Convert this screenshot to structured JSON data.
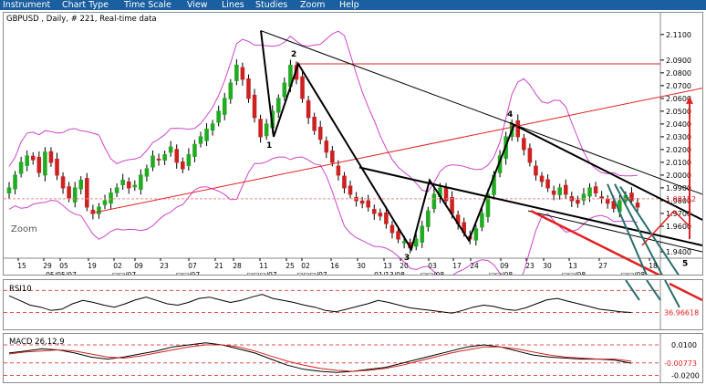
{
  "menu": [
    "Instrument",
    "Chart Type",
    "Time Scale",
    "View",
    "Lines",
    "Studies",
    "Zoom",
    "Help"
  ],
  "chart_header": "GBPUSD , Daily, # 221, Real-time data",
  "zoom_label": "Zoom",
  "colors": {
    "menubar": "#1a5f9f",
    "up": "#22aa22",
    "down": "#cc2222",
    "bands": "#cc44cc",
    "trend_red": "#e02020",
    "fan": "#2a6e6e"
  },
  "chart_data": [
    {
      "type": "candlestick",
      "title": "GBPUSD , Daily, # 221, Real-time data",
      "y_ticks": [
        "2.1100",
        "2.0900",
        "2.0800",
        "2.0700",
        "2.0600",
        "2.0500",
        "2.0400",
        "2.0300",
        "2.0200",
        "2.0100",
        "2.0000",
        "1.9900",
        "1.9800",
        "1.9700",
        "1.9600",
        "1.9400"
      ],
      "y_tick_values": [
        2.11,
        2.09,
        2.08,
        2.07,
        2.06,
        2.05,
        2.04,
        2.03,
        2.02,
        2.01,
        2.0,
        1.99,
        1.98,
        1.97,
        1.96,
        1.94
      ],
      "price_marker": "1.98152",
      "ylim": [
        1.935,
        2.117
      ],
      "x_day_labels": [
        "15",
        "29",
        "05",
        "19",
        "02",
        "09",
        "23",
        "07",
        "21",
        "28",
        "11",
        "25",
        "02",
        "16",
        "30",
        "13",
        "20",
        "03",
        "17",
        "24",
        "09",
        "23",
        "30",
        "13",
        "27",
        "18"
      ],
      "x_date_labels": [
        "05/05/07",
        "□□/07",
        "□□/07",
        "□□□/07",
        "□□□/07",
        "01/13/08",
        "□□/08",
        "□□/08",
        "□□/08",
        "□□/08"
      ],
      "wave_labels": [
        "1",
        "2",
        "3",
        "4",
        "5"
      ],
      "wave_points": [
        {
          "label": "1",
          "price": 2.03
        },
        {
          "label": "2",
          "price": 2.087
        },
        {
          "label": "3",
          "price": 1.942
        },
        {
          "label": "4",
          "price": 2.04
        },
        {
          "label": "5",
          "price": 1.9375
        }
      ],
      "close_series": [
        1.99,
        2.0,
        2.01,
        2.015,
        2.012,
        2.002,
        2.018,
        2.01,
        2.0,
        1.99,
        1.982,
        1.99,
        1.996,
        1.975,
        1.97,
        1.975,
        1.98,
        1.986,
        1.99,
        1.996,
        1.99,
        1.992,
        2.0,
        2.005,
        2.015,
        2.012,
        2.016,
        2.022,
        2.01,
        2.005,
        2.016,
        2.024,
        2.03,
        2.036,
        2.04,
        2.05,
        2.06,
        2.072,
        2.086,
        2.075,
        2.06,
        2.045,
        2.03,
        2.04,
        2.05,
        2.06,
        2.072,
        2.086,
        2.075,
        2.06,
        2.045,
        2.035,
        2.028,
        2.018,
        2.01,
        2.0,
        1.99,
        1.985,
        1.98,
        1.978,
        1.975,
        1.97,
        1.968,
        1.962,
        1.955,
        1.95,
        1.948,
        1.943,
        1.95,
        1.96,
        1.972,
        1.985,
        1.99,
        1.98,
        1.97,
        1.962,
        1.955,
        1.95,
        1.958,
        1.97,
        1.985,
        2.0,
        2.015,
        2.03,
        2.04,
        2.03,
        2.02,
        2.01,
        2.0,
        1.995,
        1.99,
        1.985,
        1.99,
        1.985,
        1.98,
        1.978,
        1.985,
        1.99,
        1.986,
        1.982,
        1.978,
        1.974,
        1.98,
        1.984,
        1.98,
        1.975
      ]
    },
    {
      "type": "line",
      "title": "RSI10",
      "reference_value": "36.96618",
      "values": [
        62,
        55,
        48,
        45,
        40,
        42,
        50,
        55,
        52,
        48,
        45,
        50,
        56,
        60,
        55,
        50,
        48,
        52,
        58,
        60,
        56,
        52,
        55,
        60,
        64,
        58,
        55,
        52,
        48,
        45,
        40,
        38,
        42,
        46,
        50,
        55,
        52,
        48,
        44,
        42,
        40,
        38,
        36,
        40,
        45,
        48,
        46,
        42,
        40,
        44,
        50,
        56,
        58,
        54,
        50,
        46,
        42,
        40,
        38,
        37
      ]
    },
    {
      "type": "line",
      "title": "MACD 26,12,9",
      "y_ticks": [
        "0.0100",
        "-0.00773",
        "-0.0200"
      ],
      "y_tick_values": [
        0.01,
        -0.00773,
        -0.02
      ],
      "ylim": [
        -0.024,
        0.018
      ],
      "macd": [
        0.002,
        0.004,
        0.006,
        0.005,
        0.002,
        -0.002,
        -0.004,
        -0.002,
        0.001,
        0.004,
        0.008,
        0.01,
        0.012,
        0.01,
        0.006,
        0.002,
        -0.004,
        -0.01,
        -0.014,
        -0.016,
        -0.017,
        -0.016,
        -0.014,
        -0.012,
        -0.008,
        -0.004,
        0.0,
        0.004,
        0.008,
        0.01,
        0.008,
        0.004,
        0.0,
        -0.002,
        -0.003,
        -0.004,
        -0.004,
        -0.005,
        -0.008
      ],
      "signal": [
        0.001,
        0.003,
        0.004,
        0.005,
        0.004,
        0.001,
        -0.002,
        -0.003,
        -0.001,
        0.002,
        0.005,
        0.008,
        0.01,
        0.01,
        0.008,
        0.004,
        -0.001,
        -0.006,
        -0.01,
        -0.013,
        -0.015,
        -0.016,
        -0.015,
        -0.013,
        -0.01,
        -0.006,
        -0.002,
        0.002,
        0.005,
        0.008,
        0.008,
        0.006,
        0.003,
        0.0,
        -0.002,
        -0.003,
        -0.004,
        -0.004,
        -0.006
      ]
    }
  ]
}
